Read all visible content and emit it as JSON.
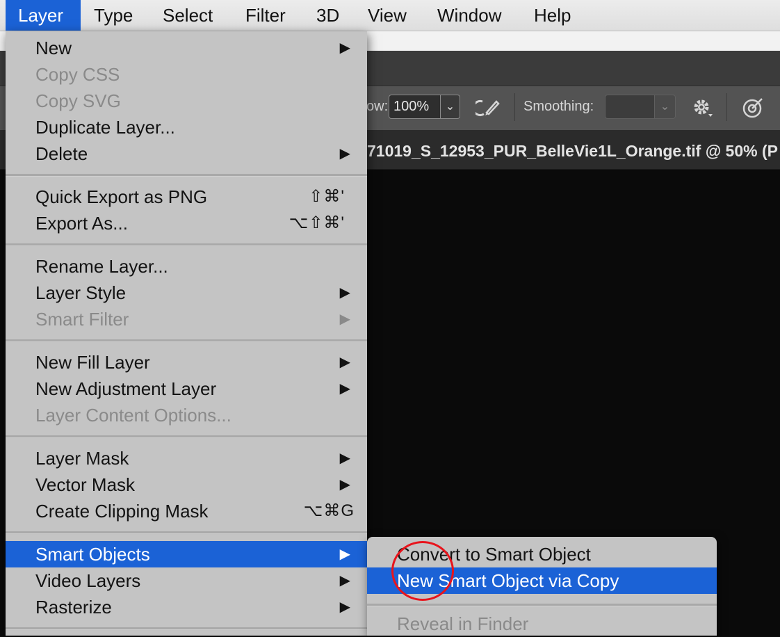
{
  "menubar": {
    "items": [
      "Layer",
      "Type",
      "Select",
      "Filter",
      "3D",
      "View",
      "Window",
      "Help"
    ]
  },
  "options_bar": {
    "flow_label_partial": "ow:",
    "flow_value": "100%",
    "smoothing_label": "Smoothing:",
    "smoothing_value": ""
  },
  "document_tab": {
    "title_partial": "71019_S_12953_PUR_BelleVie1L_Orange.tif @ 50% (P"
  },
  "layer_menu": {
    "items": [
      {
        "label": "New",
        "submenu": true,
        "enabled": true
      },
      {
        "label": "Copy CSS",
        "enabled": false
      },
      {
        "label": "Copy SVG",
        "enabled": false
      },
      {
        "label": "Duplicate Layer...",
        "enabled": true
      },
      {
        "label": "Delete",
        "submenu": true,
        "enabled": true
      },
      {
        "label": "Quick Export as PNG",
        "shortcut": "⇧⌘'",
        "enabled": true
      },
      {
        "label": "Export As...",
        "shortcut": "⌥⇧⌘'",
        "enabled": true
      },
      {
        "label": "Rename Layer...",
        "enabled": true
      },
      {
        "label": "Layer Style",
        "submenu": true,
        "enabled": true
      },
      {
        "label": "Smart Filter",
        "submenu": true,
        "enabled": false
      },
      {
        "label": "New Fill Layer",
        "submenu": true,
        "enabled": true
      },
      {
        "label": "New Adjustment Layer",
        "submenu": true,
        "enabled": true
      },
      {
        "label": "Layer Content Options...",
        "enabled": false
      },
      {
        "label": "Layer Mask",
        "submenu": true,
        "enabled": true
      },
      {
        "label": "Vector Mask",
        "submenu": true,
        "enabled": true
      },
      {
        "label": "Create Clipping Mask",
        "shortcut": "⌥⌘G",
        "enabled": true
      },
      {
        "label": "Smart Objects",
        "submenu": true,
        "enabled": true,
        "selected": true
      },
      {
        "label": "Video Layers",
        "submenu": true,
        "enabled": true
      },
      {
        "label": "Rasterize",
        "submenu": true,
        "enabled": true
      }
    ],
    "arrow_glyph": "▶"
  },
  "smart_objects_submenu": {
    "items": [
      {
        "label": "Convert to Smart Object",
        "enabled": true
      },
      {
        "label": "New Smart Object via Copy",
        "enabled": true,
        "selected": true
      },
      {
        "label": "Reveal in Finder",
        "enabled": false
      }
    ]
  },
  "colors": {
    "selection_blue": "#1b62d6",
    "menu_bg": "#c4c4c4",
    "highlight_circle": "#e8141c"
  }
}
